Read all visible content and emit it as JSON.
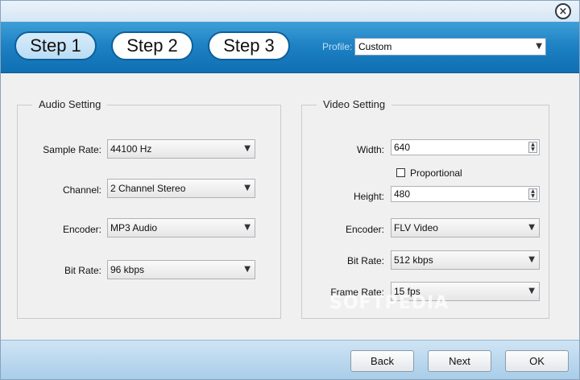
{
  "window": {
    "close_icon": "×"
  },
  "steps": [
    {
      "label": "Step 1",
      "active": true
    },
    {
      "label": "Step 2",
      "active": false
    },
    {
      "label": "Step 3",
      "active": false
    }
  ],
  "profile": {
    "label": "Profile:",
    "value": "Custom"
  },
  "audio": {
    "title": "Audio Setting",
    "sample_rate_label": "Sample Rate:",
    "sample_rate_value": "44100 Hz",
    "channel_label": "Channel:",
    "channel_value": "2 Channel Stereo",
    "encoder_label": "Encoder:",
    "encoder_value": "MP3 Audio",
    "bit_rate_label": "Bit Rate:",
    "bit_rate_value": "96 kbps"
  },
  "video": {
    "title": "Video Setting",
    "width_label": "Width:",
    "width_value": "640",
    "proportional_label": "Proportional",
    "proportional_checked": false,
    "height_label": "Height:",
    "height_value": "480",
    "encoder_label": "Encoder:",
    "encoder_value": "FLV Video",
    "bit_rate_label": "Bit Rate:",
    "bit_rate_value": "512 kbps",
    "frame_rate_label": "Frame Rate:",
    "frame_rate_value": "15 fps"
  },
  "footer": {
    "back_label": "Back",
    "next_label": "Next",
    "ok_label": "OK"
  },
  "watermark": "SOFTPEDIA",
  "icons": {
    "dropdown_arrow": "▼",
    "spin_up": "▲",
    "spin_down": "▼"
  },
  "colors": {
    "stepbar": "#1e82c4",
    "footer": "#bcd9ee"
  }
}
